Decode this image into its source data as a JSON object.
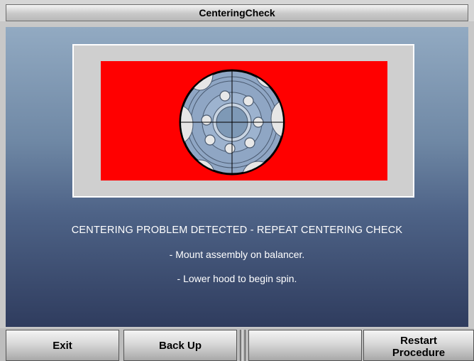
{
  "window": {
    "title": "CenteringCheck"
  },
  "main": {
    "message": "CENTERING PROBLEM DETECTED - REPEAT CENTERING CHECK",
    "instructions": [
      "- Mount assembly on balancer.",
      "- Lower hood to begin spin."
    ],
    "wheel_icon": "wheel-crosshair-icon",
    "status_color": "#ff0000"
  },
  "buttons": {
    "exit": "Exit",
    "back_up": "Back Up",
    "blank": "",
    "restart": "Restart\nProcedure"
  }
}
